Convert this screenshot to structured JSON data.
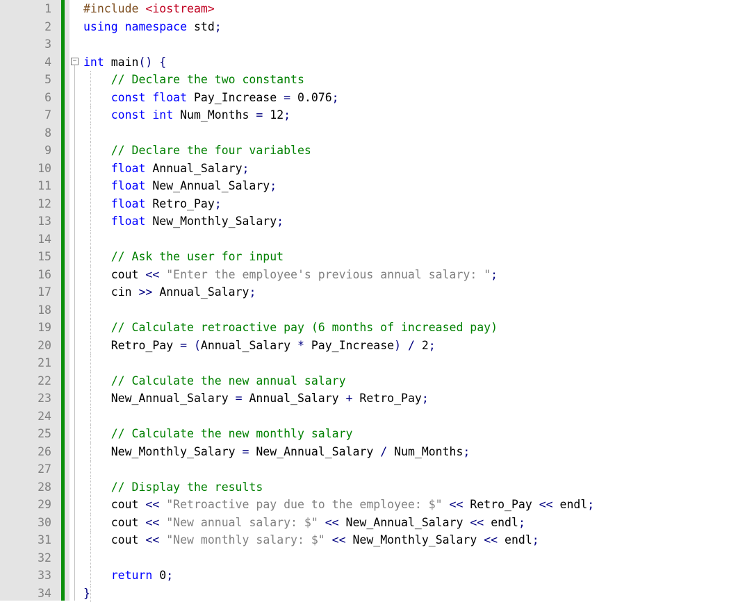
{
  "editor": {
    "lineCount": 34,
    "foldSymbol": "−",
    "lines": [
      {
        "n": 1,
        "indent": 0,
        "tokens": [
          [
            "pp",
            "#include "
          ],
          [
            "inc",
            "<iostream>"
          ]
        ]
      },
      {
        "n": 2,
        "indent": 0,
        "tokens": [
          [
            "kw",
            "using "
          ],
          [
            "kw",
            "namespace "
          ],
          [
            "name",
            "std"
          ],
          [
            "op",
            ";"
          ]
        ]
      },
      {
        "n": 3,
        "indent": 0,
        "tokens": []
      },
      {
        "n": 4,
        "indent": 0,
        "tokens": [
          [
            "kw",
            "int "
          ],
          [
            "fn",
            "main"
          ],
          [
            "op",
            "() {"
          ]
        ]
      },
      {
        "n": 5,
        "indent": 1,
        "tokens": [
          [
            "cm",
            "// Declare the two constants"
          ]
        ]
      },
      {
        "n": 6,
        "indent": 1,
        "tokens": [
          [
            "kw",
            "const "
          ],
          [
            "kw",
            "float "
          ],
          [
            "name",
            "Pay_Increase"
          ],
          [
            "op",
            " = "
          ],
          [
            "num",
            "0.076"
          ],
          [
            "op",
            ";"
          ]
        ]
      },
      {
        "n": 7,
        "indent": 1,
        "tokens": [
          [
            "kw",
            "const "
          ],
          [
            "kw",
            "int "
          ],
          [
            "name",
            "Num_Months"
          ],
          [
            "op",
            " = "
          ],
          [
            "num",
            "12"
          ],
          [
            "op",
            ";"
          ]
        ]
      },
      {
        "n": 8,
        "indent": 0,
        "tokens": []
      },
      {
        "n": 9,
        "indent": 1,
        "tokens": [
          [
            "cm",
            "// Declare the four variables"
          ]
        ]
      },
      {
        "n": 10,
        "indent": 1,
        "tokens": [
          [
            "kw",
            "float "
          ],
          [
            "name",
            "Annual_Salary"
          ],
          [
            "op",
            ";"
          ]
        ]
      },
      {
        "n": 11,
        "indent": 1,
        "tokens": [
          [
            "kw",
            "float "
          ],
          [
            "name",
            "New_Annual_Salary"
          ],
          [
            "op",
            ";"
          ]
        ]
      },
      {
        "n": 12,
        "indent": 1,
        "tokens": [
          [
            "kw",
            "float "
          ],
          [
            "name",
            "Retro_Pay"
          ],
          [
            "op",
            ";"
          ]
        ]
      },
      {
        "n": 13,
        "indent": 1,
        "tokens": [
          [
            "kw",
            "float "
          ],
          [
            "name",
            "New_Monthly_Salary"
          ],
          [
            "op",
            ";"
          ]
        ]
      },
      {
        "n": 14,
        "indent": 0,
        "tokens": []
      },
      {
        "n": 15,
        "indent": 1,
        "tokens": [
          [
            "cm",
            "// Ask the user for input"
          ]
        ]
      },
      {
        "n": 16,
        "indent": 1,
        "tokens": [
          [
            "name",
            "cout"
          ],
          [
            "op",
            " << "
          ],
          [
            "str",
            "\"Enter the employee's previous annual salary: \""
          ],
          [
            "op",
            ";"
          ]
        ]
      },
      {
        "n": 17,
        "indent": 1,
        "tokens": [
          [
            "name",
            "cin"
          ],
          [
            "op",
            " >> "
          ],
          [
            "name",
            "Annual_Salary"
          ],
          [
            "op",
            ";"
          ]
        ]
      },
      {
        "n": 18,
        "indent": 0,
        "tokens": []
      },
      {
        "n": 19,
        "indent": 1,
        "tokens": [
          [
            "cm",
            "// Calculate retroactive pay (6 months of increased pay)"
          ]
        ]
      },
      {
        "n": 20,
        "indent": 1,
        "tokens": [
          [
            "name",
            "Retro_Pay"
          ],
          [
            "op",
            " = ("
          ],
          [
            "name",
            "Annual_Salary"
          ],
          [
            "op",
            " * "
          ],
          [
            "name",
            "Pay_Increase"
          ],
          [
            "op",
            ") / "
          ],
          [
            "num",
            "2"
          ],
          [
            "op",
            ";"
          ]
        ]
      },
      {
        "n": 21,
        "indent": 0,
        "tokens": []
      },
      {
        "n": 22,
        "indent": 1,
        "tokens": [
          [
            "cm",
            "// Calculate the new annual salary"
          ]
        ]
      },
      {
        "n": 23,
        "indent": 1,
        "tokens": [
          [
            "name",
            "New_Annual_Salary"
          ],
          [
            "op",
            " = "
          ],
          [
            "name",
            "Annual_Salary"
          ],
          [
            "op",
            " + "
          ],
          [
            "name",
            "Retro_Pay"
          ],
          [
            "op",
            ";"
          ]
        ]
      },
      {
        "n": 24,
        "indent": 0,
        "tokens": []
      },
      {
        "n": 25,
        "indent": 1,
        "tokens": [
          [
            "cm",
            "// Calculate the new monthly salary"
          ]
        ]
      },
      {
        "n": 26,
        "indent": 1,
        "tokens": [
          [
            "name",
            "New_Monthly_Salary"
          ],
          [
            "op",
            " = "
          ],
          [
            "name",
            "New_Annual_Salary"
          ],
          [
            "op",
            " / "
          ],
          [
            "name",
            "Num_Months"
          ],
          [
            "op",
            ";"
          ]
        ]
      },
      {
        "n": 27,
        "indent": 0,
        "tokens": []
      },
      {
        "n": 28,
        "indent": 1,
        "tokens": [
          [
            "cm",
            "// Display the results"
          ]
        ]
      },
      {
        "n": 29,
        "indent": 1,
        "tokens": [
          [
            "name",
            "cout"
          ],
          [
            "op",
            " << "
          ],
          [
            "str",
            "\"Retroactive pay due to the employee: $\""
          ],
          [
            "op",
            " << "
          ],
          [
            "name",
            "Retro_Pay"
          ],
          [
            "op",
            " << "
          ],
          [
            "name",
            "endl"
          ],
          [
            "op",
            ";"
          ]
        ]
      },
      {
        "n": 30,
        "indent": 1,
        "tokens": [
          [
            "name",
            "cout"
          ],
          [
            "op",
            " << "
          ],
          [
            "str",
            "\"New annual salary: $\""
          ],
          [
            "op",
            " << "
          ],
          [
            "name",
            "New_Annual_Salary"
          ],
          [
            "op",
            " << "
          ],
          [
            "name",
            "endl"
          ],
          [
            "op",
            ";"
          ]
        ]
      },
      {
        "n": 31,
        "indent": 1,
        "tokens": [
          [
            "name",
            "cout"
          ],
          [
            "op",
            " << "
          ],
          [
            "str",
            "\"New monthly salary: $\""
          ],
          [
            "op",
            " << "
          ],
          [
            "name",
            "New_Monthly_Salary"
          ],
          [
            "op",
            " << "
          ],
          [
            "name",
            "endl"
          ],
          [
            "op",
            ";"
          ]
        ]
      },
      {
        "n": 32,
        "indent": 0,
        "tokens": []
      },
      {
        "n": 33,
        "indent": 1,
        "tokens": [
          [
            "kw",
            "return "
          ],
          [
            "num",
            "0"
          ],
          [
            "op",
            ";"
          ]
        ]
      },
      {
        "n": 34,
        "indent": 0,
        "tokens": [
          [
            "op",
            "}"
          ]
        ]
      }
    ]
  }
}
